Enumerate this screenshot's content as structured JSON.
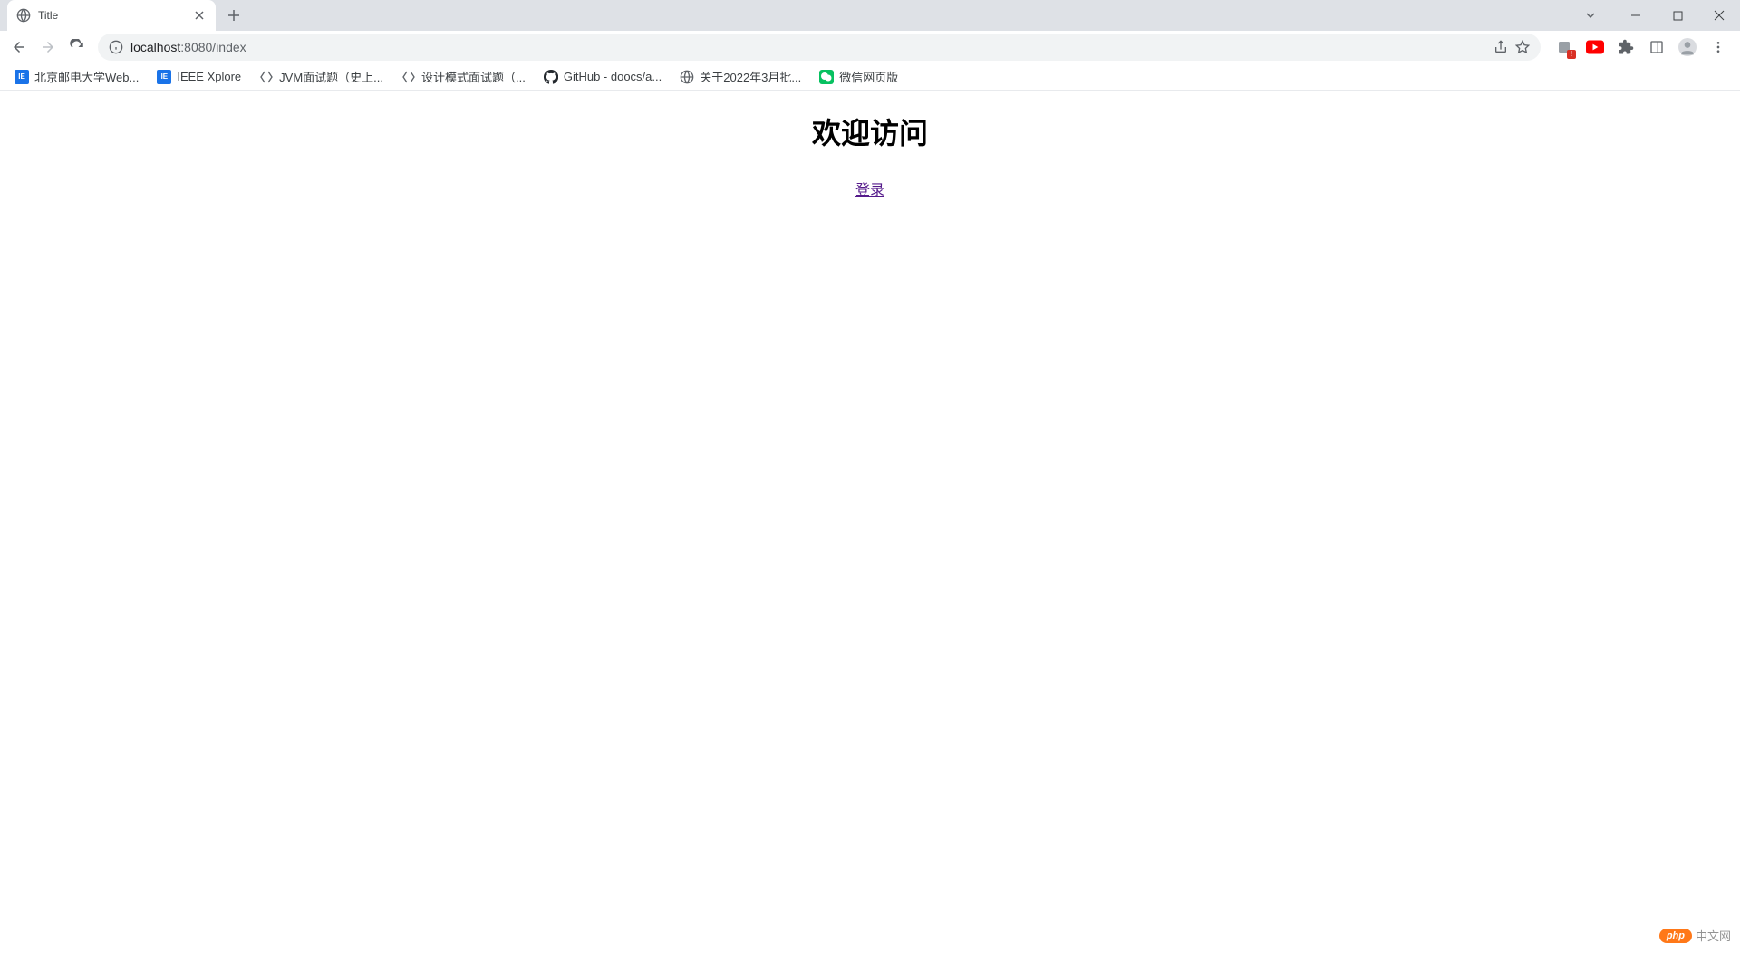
{
  "tab": {
    "title": "Title"
  },
  "url": {
    "host": "localhost",
    "rest": ":8080/index"
  },
  "bookmarks": [
    {
      "icon": "blue-square",
      "label": "北京邮电大学Web..."
    },
    {
      "icon": "blue-square",
      "label": "IEEE Xplore"
    },
    {
      "icon": "script",
      "label": "JVM面试题（史上..."
    },
    {
      "icon": "script",
      "label": "设计模式面试题（..."
    },
    {
      "icon": "github",
      "label": "GitHub - doocs/a..."
    },
    {
      "icon": "globe",
      "label": "关于2022年3月批..."
    },
    {
      "icon": "wechat",
      "label": "微信网页版"
    }
  ],
  "page": {
    "heading": "欢迎访问",
    "login_link": "登录"
  },
  "watermark": {
    "badge": "php",
    "text": "中文网"
  }
}
